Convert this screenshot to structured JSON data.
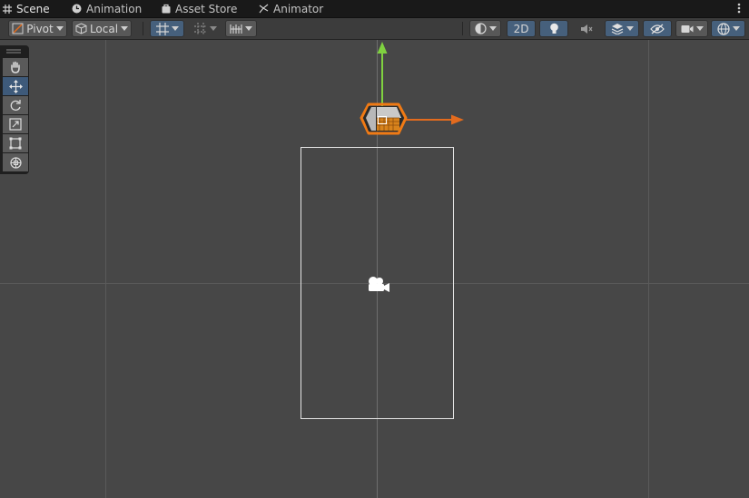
{
  "tabs": [
    {
      "label": "Scene",
      "icon": "grid-icon",
      "active": true
    },
    {
      "label": "Animation",
      "icon": "clock-icon"
    },
    {
      "label": "Asset Store",
      "icon": "bag-icon"
    },
    {
      "label": "Animator",
      "icon": "animator-icon"
    }
  ],
  "toolbar": {
    "pivot_label": "Pivot",
    "local_label": "Local",
    "mode_2d_label": "2D"
  },
  "colors": {
    "panel": "#474747",
    "toolbar": "#3c3c3c",
    "tabbar": "#191919",
    "selected": "#46607c",
    "gizmo_y": "#7fd140",
    "gizmo_x": "#e36b1e",
    "outline": "#f07a14"
  },
  "tools": [
    "hand-icon",
    "move-icon",
    "rotate-icon",
    "scale-icon",
    "rect-tool-icon",
    "transform-icon"
  ]
}
